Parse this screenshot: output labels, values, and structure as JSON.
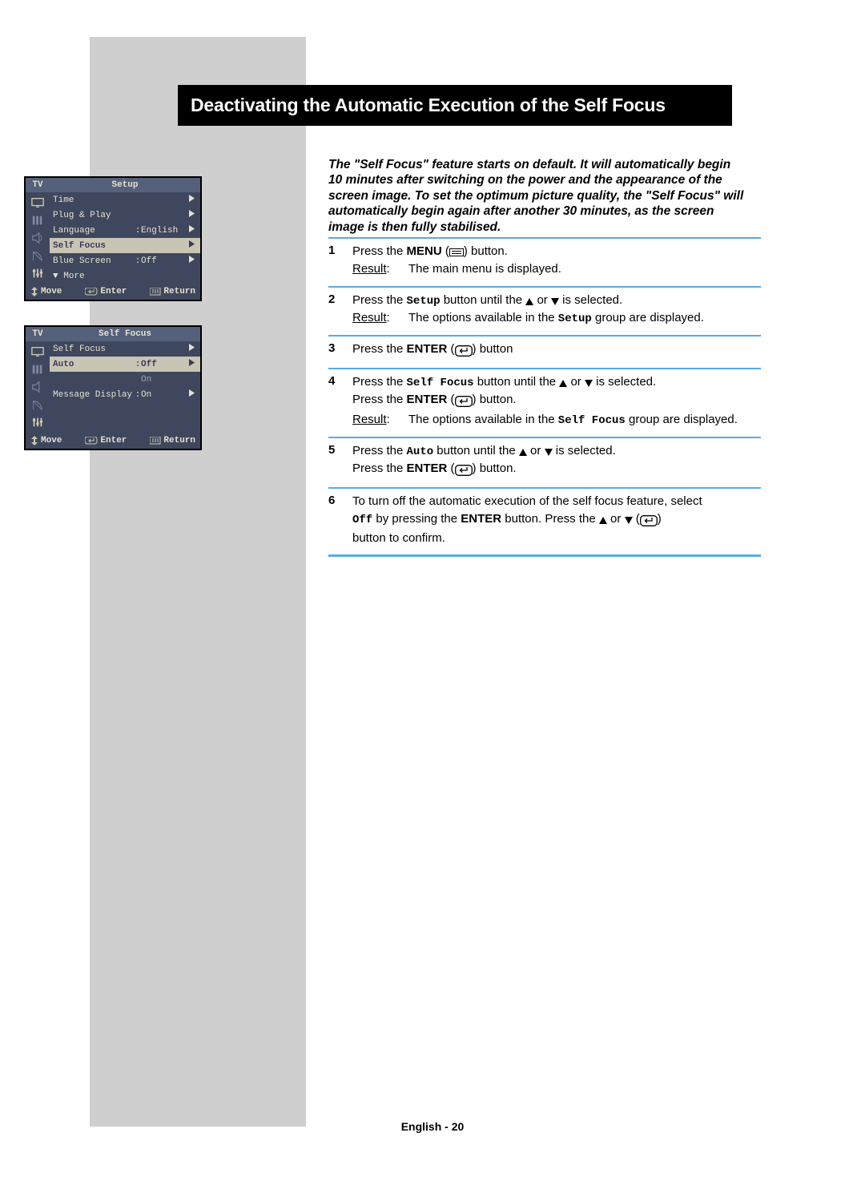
{
  "title": "Deactivating the Automatic Execution of the Self Focus",
  "description": "The \"Self Focus\" feature starts on default.  It will automatically begin 10 minutes after switching on the power and the appearance of the screen image. To set the optimum picture quality, the \"Self Focus\" will automatically begin again after another 30 minutes, as the screen image is then fully stabilised.",
  "button_labels": {
    "menu": "MENU",
    "enter": "ENTER"
  },
  "result_label": "Result",
  "steps": [
    {
      "num": "1",
      "lines": [
        {
          "t": "Press the ",
          "bold": "MENU",
          "post": " (",
          "icon": "menu",
          "tail": ")  button."
        }
      ],
      "result": "The main menu is displayed."
    },
    {
      "num": "2",
      "lines": [
        {
          "t": "Press the ",
          "icon": "up",
          "mid": " or ",
          "icon2": "down",
          "post": " button until the ",
          "mono": "Setup",
          "tail": " is selected."
        }
      ],
      "result_pre": "The options available in the ",
      "result_mono": "Setup",
      "result_post": " group are displayed."
    },
    {
      "num": "3",
      "lines": [
        {
          "t": "Press the ",
          "bold": "ENTER",
          "post": " (",
          "icon": "enter",
          "tail": ") button"
        }
      ]
    },
    {
      "num": "4",
      "lines": [
        {
          "t": "Press the ",
          "icon": "up",
          "mid": " or ",
          "icon2": "down",
          "post": " button until the ",
          "mono": "Self Focus",
          "tail": " is selected."
        },
        {
          "t": "Press the ",
          "bold": "ENTER",
          "post": " (",
          "icon": "enter",
          "tail": ") button."
        }
      ],
      "result_pre": "The options available in the ",
      "result_mono": "Self Focus",
      "result_post": " group are displayed."
    },
    {
      "num": "5",
      "lines": [
        {
          "t": "Press the ",
          "icon": "up",
          "mid": " or ",
          "icon2": "down",
          "post": " button until the ",
          "mono": "Auto",
          "tail": " is selected."
        },
        {
          "t": "Press the ",
          "bold": "ENTER",
          "post": " (",
          "icon": "enter",
          "tail": ") button."
        }
      ]
    },
    {
      "num": "6",
      "lines": [
        {
          "t": "To turn off the automatic execution of the self focus feature, select "
        },
        {
          "mono": "Off",
          "t2": " by pressing the ",
          "icon": "up",
          "mid": " or ",
          "icon2": "down",
          "post": " button. Press the ",
          "bold": "ENTER",
          "post2": " (",
          "icon3": "enter",
          "tail": ") "
        },
        {
          "t": "button to confirm."
        }
      ]
    }
  ],
  "osd": {
    "tv": "TV",
    "move": "Move",
    "enter": "Enter",
    "return": "Return",
    "menu1": {
      "title": "Setup",
      "rows": [
        {
          "label": "Time",
          "arrow": true
        },
        {
          "label": "Plug & Play",
          "arrow": true
        },
        {
          "label": "Language",
          "sep": ":",
          "val": "English",
          "arrow": true
        },
        {
          "label": "Self Focus",
          "arrow": true,
          "sel": true
        },
        {
          "label": "Blue Screen",
          "sep": ":",
          "val": "Off",
          "arrow": true
        },
        {
          "label": "▼ More"
        }
      ]
    },
    "menu2": {
      "title": "Self Focus",
      "rows": [
        {
          "label": "Self Focus",
          "arrow": true
        },
        {
          "label": "Auto",
          "sep": ":",
          "val": "Off",
          "arrow": true,
          "sel": true,
          "dim": false
        },
        {
          "label": "",
          "sep": "",
          "val": "On",
          "dim": true
        },
        {
          "label": "Message Display",
          "sep": ":",
          "val": "On",
          "arrow": true
        }
      ]
    }
  },
  "footer": "English - 20"
}
